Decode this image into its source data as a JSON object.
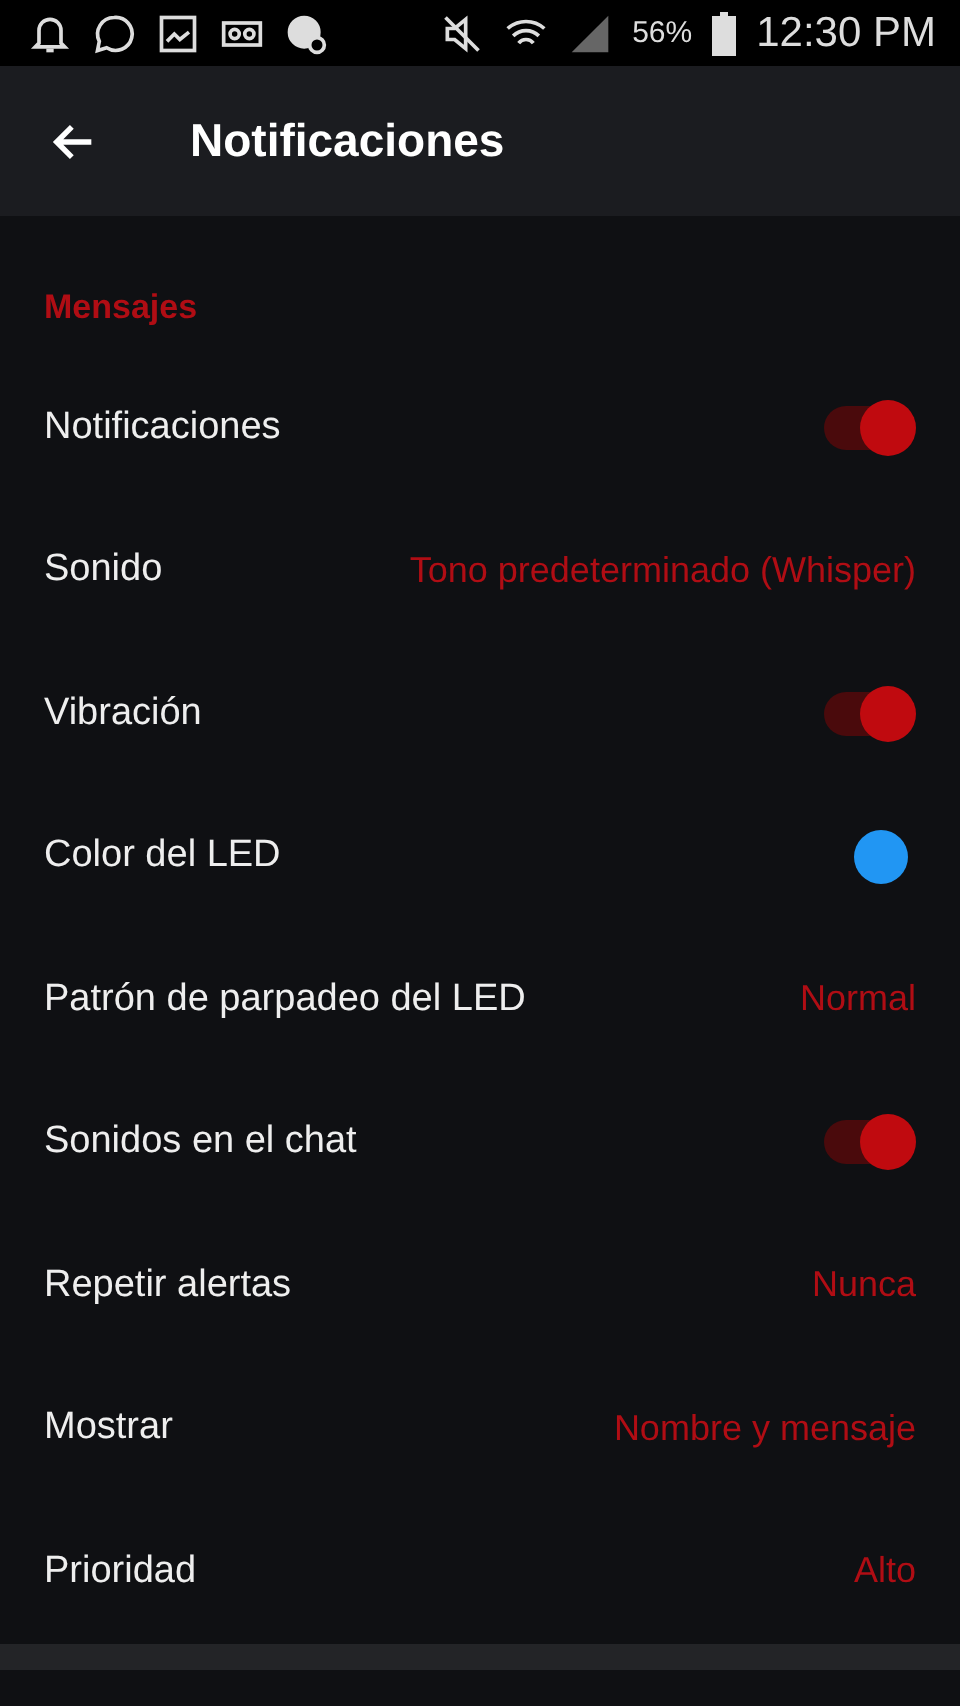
{
  "status_bar": {
    "battery": "56%",
    "time": "12:30 PM"
  },
  "app_bar": {
    "title": "Notificaciones"
  },
  "section": {
    "title": "Mensajes"
  },
  "rows": [
    {
      "kind": "switch",
      "label": "Notificaciones",
      "on": true
    },
    {
      "kind": "value",
      "label": "Sonido",
      "value": "Tono predeterminado (Whisper)"
    },
    {
      "kind": "switch",
      "label": "Vibración",
      "on": true
    },
    {
      "kind": "color",
      "label": "Color del LED",
      "color": "#2196f3"
    },
    {
      "kind": "value",
      "label": "Patrón de parpadeo del LED",
      "value": "Normal"
    },
    {
      "kind": "switch",
      "label": "Sonidos en el chat",
      "on": true
    },
    {
      "kind": "value",
      "label": "Repetir alertas",
      "value": "Nunca"
    },
    {
      "kind": "value",
      "label": "Mostrar",
      "value": "Nombre y mensaje"
    },
    {
      "kind": "value",
      "label": "Prioridad",
      "value": "Alto"
    }
  ]
}
